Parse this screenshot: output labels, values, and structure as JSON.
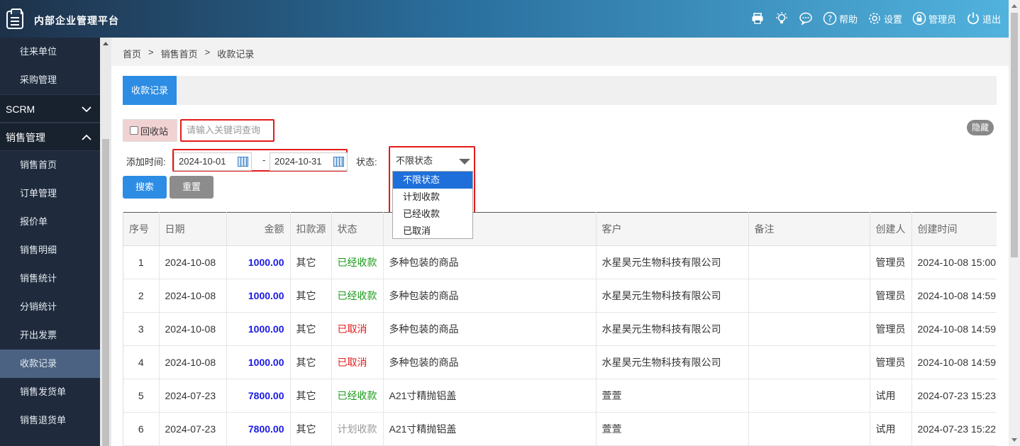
{
  "header": {
    "title": "内部企业管理平台",
    "tools": {
      "help": "帮助",
      "settings": "设置",
      "admin": "管理员",
      "logout": "退出"
    }
  },
  "sidebar": {
    "top_items": [
      "往来单位",
      "采购管理"
    ],
    "groups": {
      "scrm": "SCRM",
      "sales": "销售管理"
    },
    "sales_items": [
      "销售首页",
      "订单管理",
      "报价单",
      "销售明细",
      "销售统计",
      "分销统计",
      "开出发票",
      "收款记录",
      "销售发货单",
      "销售退货单"
    ],
    "active": "收款记录"
  },
  "breadcrumb": {
    "home": "首页",
    "sep": ">",
    "sales_home": "销售首页",
    "current": "收款记录"
  },
  "tab": {
    "label": "收款记录"
  },
  "filters": {
    "recycle_label": "回收站",
    "keyword_placeholder": "请输入关键词查询",
    "hide_label": "隐藏",
    "date_label": "添加时间:",
    "date_from": "2024-10-01",
    "date_sep": "-",
    "date_to": "2024-10-31",
    "status_label": "状态:",
    "status_selected": "不限状态",
    "status_options": [
      "不限状态",
      "计划收款",
      "已经收款",
      "已取消"
    ],
    "search_label": "搜索",
    "reset_label": "重置"
  },
  "table": {
    "columns": [
      "序号",
      "日期",
      "金额",
      "扣款源",
      "状态",
      "",
      "客户",
      "备注",
      "创建人",
      "创建时间"
    ],
    "rows": [
      [
        "1",
        "2024-10-08",
        "1000.00",
        "其它",
        "已经收款",
        "多种包装的商品",
        "水星昊元生物科技有限公司",
        "",
        "管理员",
        "2024-10-08 15:00"
      ],
      [
        "2",
        "2024-10-08",
        "1000.00",
        "其它",
        "已经收款",
        "多种包装的商品",
        "水星昊元生物科技有限公司",
        "",
        "管理员",
        "2024-10-08 14:59"
      ],
      [
        "3",
        "2024-10-08",
        "1000.00",
        "其它",
        "已取消",
        "多种包装的商品",
        "水星昊元生物科技有限公司",
        "",
        "管理员",
        "2024-10-08 14:59"
      ],
      [
        "4",
        "2024-10-08",
        "1000.00",
        "其它",
        "已取消",
        "多种包装的商品",
        "水星昊元生物科技有限公司",
        "",
        "管理员",
        "2024-10-08 14:59"
      ],
      [
        "5",
        "2024-07-23",
        "7800.00",
        "其它",
        "已经收款",
        "A21寸精抛铝盖",
        "萱萱",
        "",
        "试用",
        "2024-07-23 15:23"
      ],
      [
        "6",
        "2024-07-23",
        "7800.00",
        "其它",
        "计划收款",
        "A21寸精抛铝盖",
        "萱萱",
        "",
        "试用",
        "2024-07-23 15:22"
      ]
    ]
  },
  "colors": {
    "accent": "#2d8ce3",
    "highlight": "#e31b1b",
    "done": "#1a9a1a",
    "amount": "#1a1ae6"
  }
}
